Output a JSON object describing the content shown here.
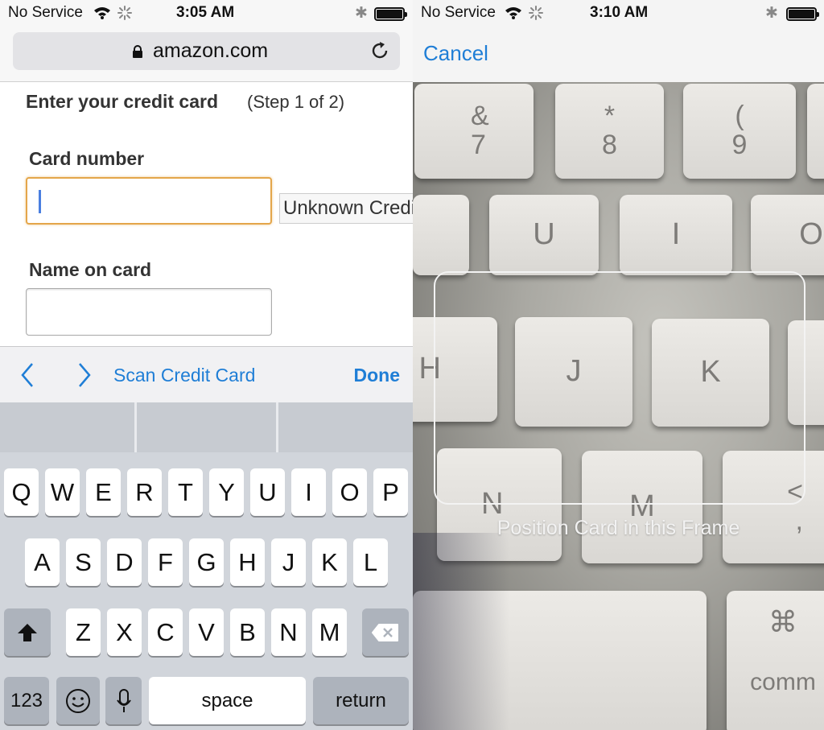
{
  "left": {
    "status": {
      "carrier": "No Service",
      "time": "3:05 AM"
    },
    "url": "amazon.com",
    "page": {
      "heading": "Enter your credit card",
      "step": "(Step 1 of 2)",
      "card_number_label": "Card number",
      "card_type": "Unknown Credit Card",
      "name_label": "Name on card"
    },
    "accessory": {
      "scan": "Scan Credit Card",
      "done": "Done"
    },
    "keyboard": {
      "row1": [
        "Q",
        "W",
        "E",
        "R",
        "T",
        "Y",
        "U",
        "I",
        "O",
        "P"
      ],
      "row2": [
        "A",
        "S",
        "D",
        "F",
        "G",
        "H",
        "J",
        "K",
        "L"
      ],
      "row3": [
        "Z",
        "X",
        "C",
        "V",
        "B",
        "N",
        "M"
      ],
      "numbers": "123",
      "space": "space",
      "return": "return"
    }
  },
  "right": {
    "status": {
      "carrier": "No Service",
      "time": "3:10 AM"
    },
    "cancel": "Cancel",
    "frame_hint": "Position Card in this Frame",
    "photo_keys": {
      "k7": [
        "&",
        "7"
      ],
      "k8": [
        "*",
        "8"
      ],
      "k9": [
        "(",
        "9"
      ],
      "u": "U",
      "i": "I",
      "o": "O",
      "h": "H",
      "j": "J",
      "k": "K",
      "n": "N",
      "m": "M",
      "lt": "<",
      "comma": ",",
      "cmd": "⌘",
      "command": "comm"
    }
  },
  "colors": {
    "ios_blue": "#1f7ed6",
    "focus_orange": "#e4a64a",
    "keyboard_bg": "#d1d5db"
  }
}
